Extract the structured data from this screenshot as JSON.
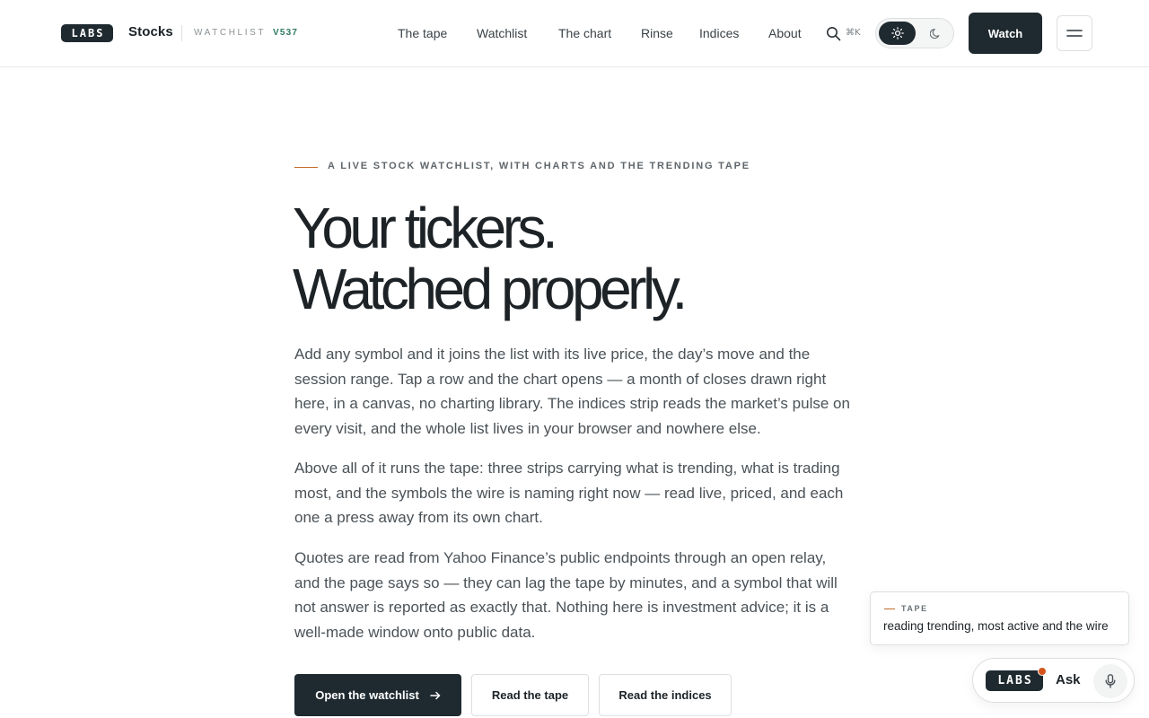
{
  "header": {
    "logo_text": "LABS",
    "brand": "Stocks",
    "section_label": "WATCHLIST",
    "version": "V537",
    "nav": [
      {
        "label": "The tape"
      },
      {
        "label": "Watchlist"
      },
      {
        "label": "The chart"
      },
      {
        "label": "Rinse"
      },
      {
        "label": "Indices"
      },
      {
        "label": "About"
      }
    ],
    "search_shortcut": "⌘K",
    "theme_selected": "light",
    "watch_button": "Watch"
  },
  "hero": {
    "eyebrow": "A LIVE STOCK WATCHLIST, WITH CHARTS AND THE TRENDING TAPE",
    "title_line1": "Your tickers.",
    "title_line2": "Watched properly.",
    "paragraphs": [
      "Add any symbol and it joins the list with its live price, the day’s move and the session range. Tap a row and the chart opens — a month of closes drawn right here, in a canvas, no charting library. The indices strip reads the market’s pulse on every visit, and the whole list lives in your browser and nowhere else.",
      "Above all of it runs the tape: three strips carrying what is trending, what is trading most, and the symbols the wire is naming right now — read live, priced, and each one a press away from its own chart.",
      "Quotes are read from Yahoo Finance’s public endpoints through an open relay, and the page says so — they can lag the tape by minutes, and a symbol that will not answer is reported as exactly that. Nothing here is investment advice; it is a well-made window onto public data."
    ],
    "buttons": {
      "primary": "Open the watchlist",
      "tape": "Read the tape",
      "indices": "Read the indices"
    }
  },
  "toast": {
    "label": "TAPE",
    "text": "reading trending, most active and the wire"
  },
  "ask": {
    "logo_text": "LABS",
    "label": "Ask"
  },
  "colors": {
    "ink": "#1f2a30",
    "accent_orange": "#c56a28",
    "accent_green": "#2f7a5f",
    "notification_dot": "#d5541c"
  },
  "icons": [
    "search-icon",
    "sun-icon",
    "moon-icon",
    "hamburger-menu-icon",
    "arrow-right-icon",
    "mic-icon"
  ]
}
